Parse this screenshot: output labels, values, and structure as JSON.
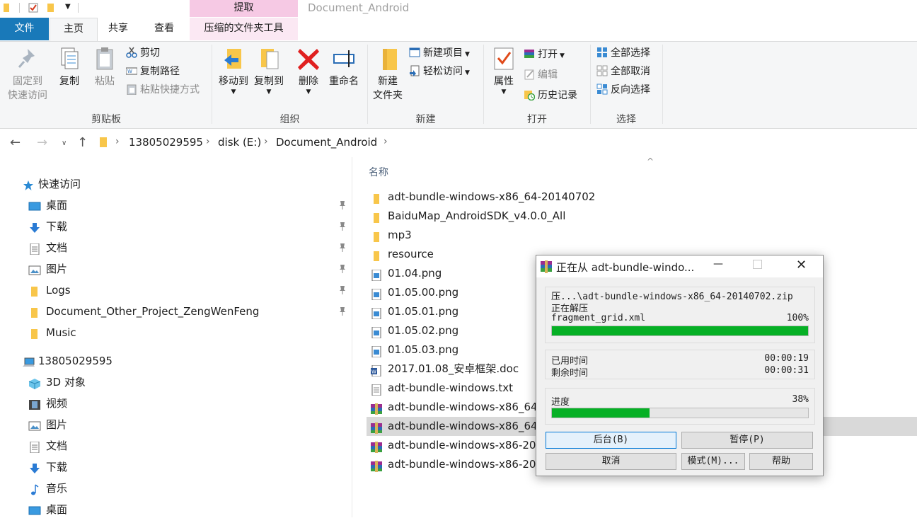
{
  "window": {
    "title": "Document_Android",
    "context_header": "提取",
    "tabs": {
      "file": "文件",
      "home": "主页",
      "share": "共享",
      "view": "查看",
      "context_tab": "压缩的文件夹工具"
    }
  },
  "ribbon": {
    "clipboard": {
      "group": "剪贴板",
      "pin_line1": "固定到",
      "pin_line2": "快速访问",
      "copy": "复制",
      "paste": "粘贴",
      "cut": "剪切",
      "copy_path": "复制路径",
      "paste_shortcut": "粘贴快捷方式"
    },
    "organize": {
      "group": "组织",
      "move_to": "移动到",
      "copy_to": "复制到",
      "delete": "删除",
      "rename": "重命名"
    },
    "new": {
      "group": "新建",
      "new_folder_line1": "新建",
      "new_folder_line2": "文件夹",
      "new_item": "新建项目",
      "easy_access": "轻松访问"
    },
    "open": {
      "group": "打开",
      "properties": "属性",
      "open": "打开",
      "edit": "编辑",
      "history": "历史记录"
    },
    "select": {
      "group": "选择",
      "select_all": "全部选择",
      "select_none": "全部取消",
      "invert": "反向选择"
    }
  },
  "address": {
    "crumbs": [
      "13805029595",
      "disk (E:)",
      "Document_Android"
    ]
  },
  "nav": {
    "quick_access": "快速访问",
    "quick_items": [
      "桌面",
      "下载",
      "文档",
      "图片",
      "Logs",
      "Document_Other_Project_ZengWenFeng",
      "Music"
    ],
    "this_pc": "13805029595",
    "pc_items": [
      "3D 对象",
      "视频",
      "图片",
      "文档",
      "下载",
      "音乐",
      "桌面"
    ]
  },
  "files": {
    "column_name": "名称",
    "items": [
      "adt-bundle-windows-x86_64-20140702",
      "BaiduMap_AndroidSDK_v4.0.0_All",
      "mp3",
      "resource",
      "01.04.png",
      "01.05.00.png",
      "01.05.01.png",
      "01.05.02.png",
      "01.05.03.png",
      "2017.01.08_安卓框架.doc",
      "adt-bundle-windows.txt",
      "adt-bundle-windows-x86_64",
      "adt-bundle-windows-x86_64",
      "adt-bundle-windows-x86-20",
      "adt-bundle-windows-x86-20"
    ],
    "selected_index": 12
  },
  "dialog": {
    "title": "正在从 adt-bundle-windo...",
    "archive_path": "压...\\adt-bundle-windows-x86_64-20140702.zip",
    "status": "正在解压",
    "current_file": "fragment_grid.xml",
    "file_percent_label": "100%",
    "file_progress": 1.0,
    "elapsed_label": "已用时间",
    "elapsed_value": "00:00:19",
    "remaining_label": "剩余时间",
    "remaining_value": "00:00:31",
    "progress_label": "进度",
    "progress_percent_label": "38%",
    "total_progress": 0.38,
    "buttons": {
      "background": "后台(B)",
      "pause": "暂停(P)",
      "cancel": "取消",
      "mode": "模式(M)...",
      "help": "帮助"
    }
  }
}
